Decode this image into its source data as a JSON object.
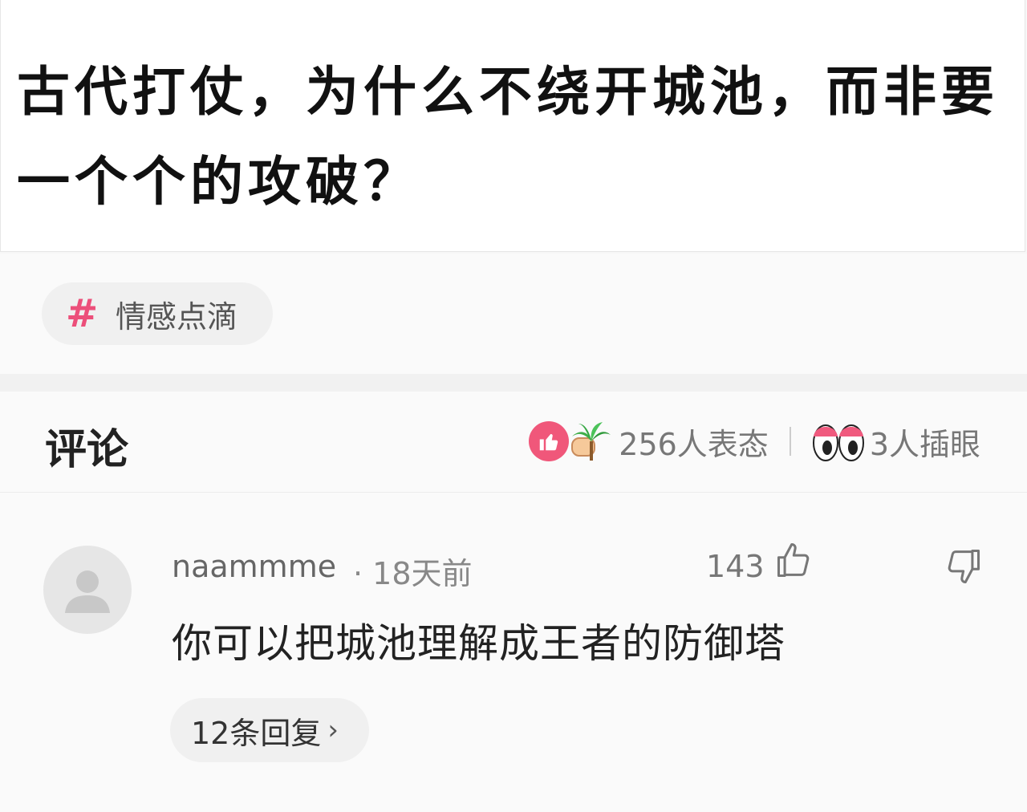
{
  "post": {
    "title": "古代打仗，为什么不绕开城池，而非要一个个的攻破？"
  },
  "tag": {
    "icon": "hash-icon",
    "label": "情感点滴",
    "color": "#ec4f7a"
  },
  "comments_section": {
    "title": "评论",
    "reactions": {
      "icons": [
        "like-icon",
        "palm-tree-icon"
      ],
      "count_label": "256人表态"
    },
    "stare": {
      "icon": "eyes-icon",
      "count_label": "3人插眼"
    }
  },
  "comment": {
    "user_name": "naammme",
    "time": "· 18天前",
    "likes": "143",
    "text": "你可以把城池理解成王者的防御塔",
    "reply_label": "12条回复",
    "reply_arrow": "›"
  }
}
